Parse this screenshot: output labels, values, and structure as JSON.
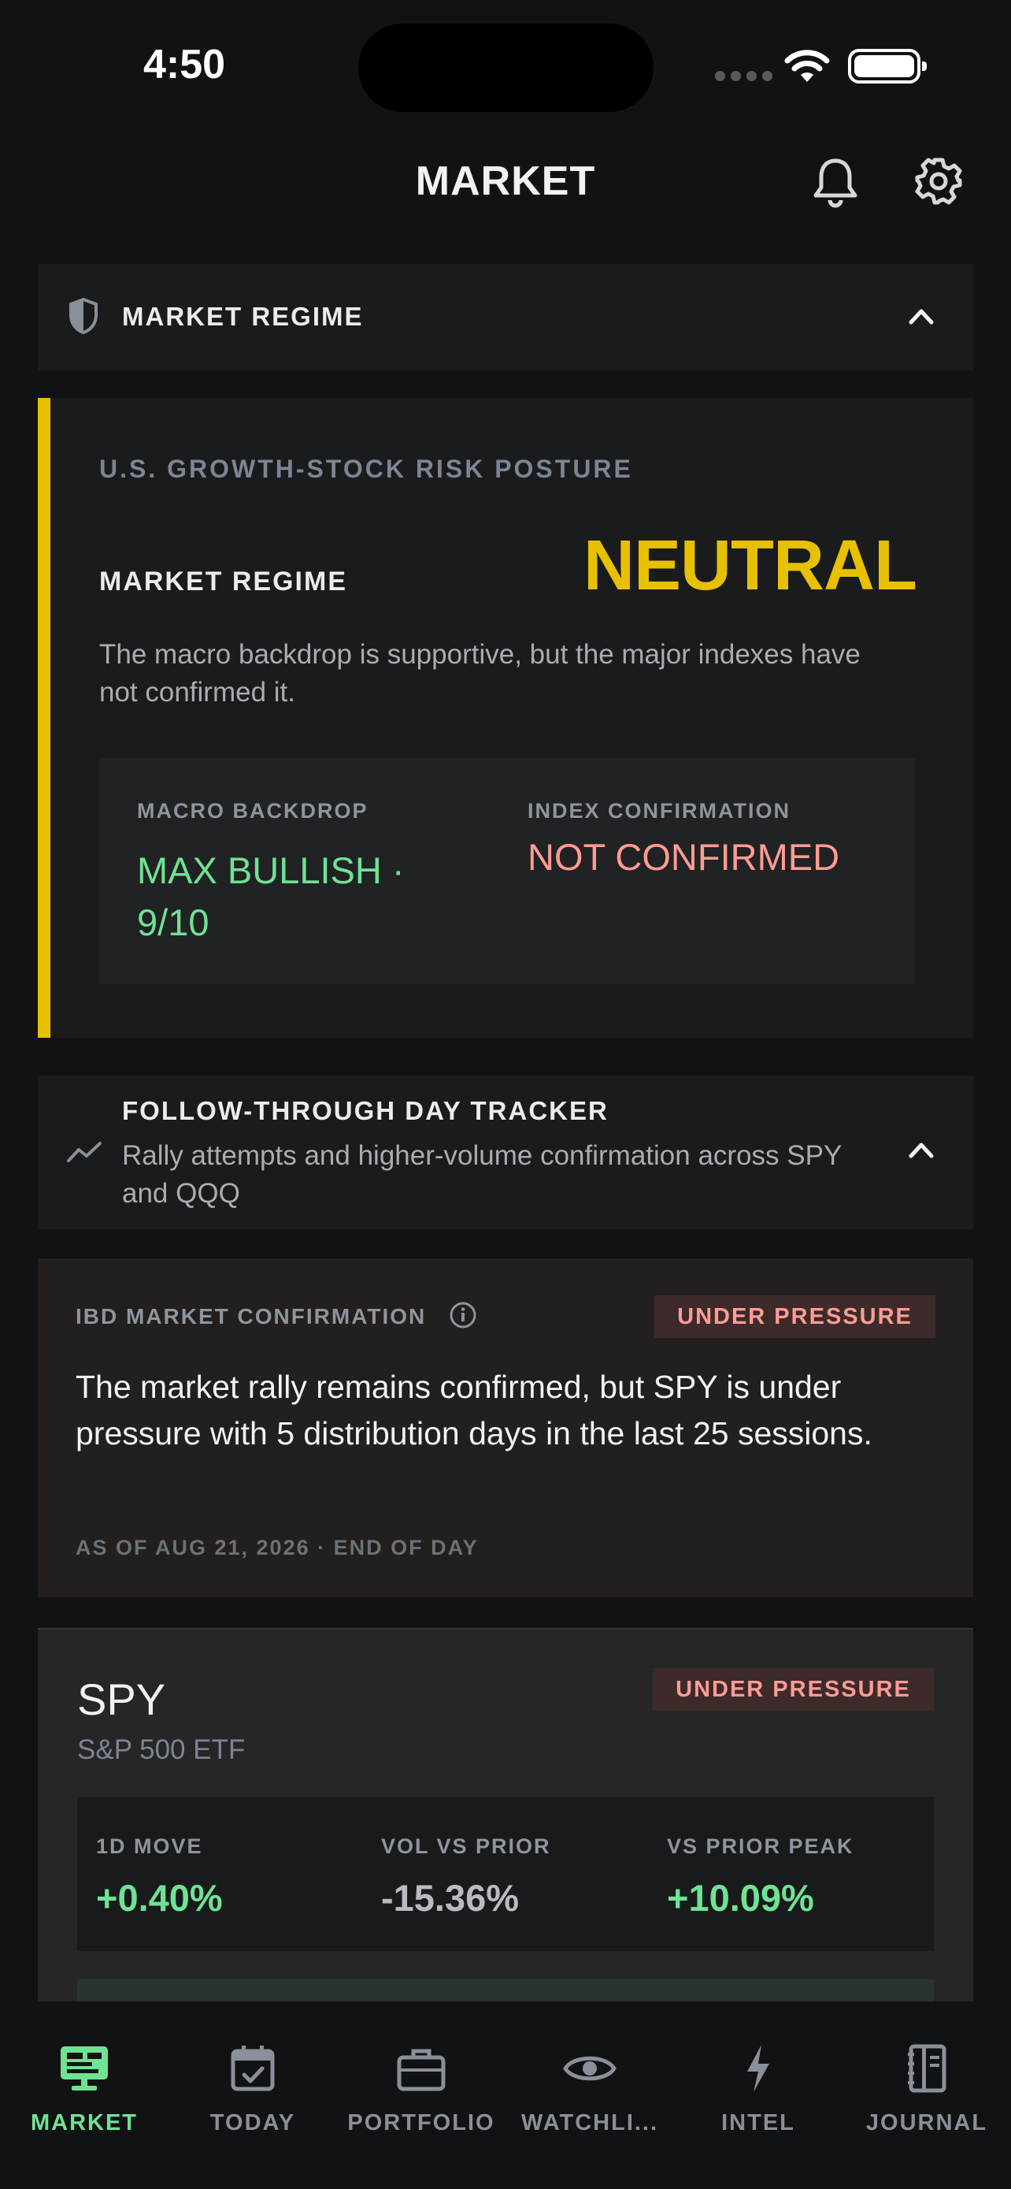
{
  "status_bar": {
    "time": "4:50"
  },
  "header": {
    "title": "MARKET",
    "bell_icon": "bell-icon",
    "settings_icon": "gear-icon"
  },
  "market_regime_section": {
    "label": "MARKET REGIME",
    "card": {
      "eyebrow": "U.S. GROWTH-STOCK RISK POSTURE",
      "label": "MARKET REGIME",
      "value": "NEUTRAL",
      "description": "The macro backdrop is supportive, but the major indexes have not confirmed it.",
      "macro_label": "MACRO BACKDROP",
      "macro_value": "MAX BULLISH · 9/10",
      "index_label": "INDEX CONFIRMATION",
      "index_value": "NOT CONFIRMED"
    }
  },
  "ftd_section": {
    "title": "FOLLOW-THROUGH DAY TRACKER",
    "subtitle": "Rally attempts and higher-volume confirmation across SPY and QQQ"
  },
  "ibd_card": {
    "title": "IBD MARKET CONFIRMATION",
    "badge": "UNDER PRESSURE",
    "text": "The market rally remains confirmed, but SPY is under pressure with 5 distribution days in the last 25 sessions.",
    "as_of": "AS OF AUG 21, 2026 · END OF DAY"
  },
  "spy_card": {
    "ticker": "SPY",
    "name": "S&P 500 ETF",
    "badge": "UNDER PRESSURE",
    "metrics": [
      {
        "label": "1D MOVE",
        "value": "+0.40%"
      },
      {
        "label": "VOL VS PRIOR",
        "value": "-15.36%"
      },
      {
        "label": "VS PRIOR PEAK",
        "value": "+10.09%"
      }
    ]
  },
  "tabs": [
    {
      "label": "MARKET",
      "active": true
    },
    {
      "label": "TODAY"
    },
    {
      "label": "PORTFOLIO"
    },
    {
      "label": "WATCHLI..."
    },
    {
      "label": "INTEL"
    },
    {
      "label": "JOURNAL"
    }
  ],
  "colors": {
    "accent_green": "#6fe394",
    "regime_yellow": "#e7c000",
    "warning_red": "#ff9c94"
  }
}
